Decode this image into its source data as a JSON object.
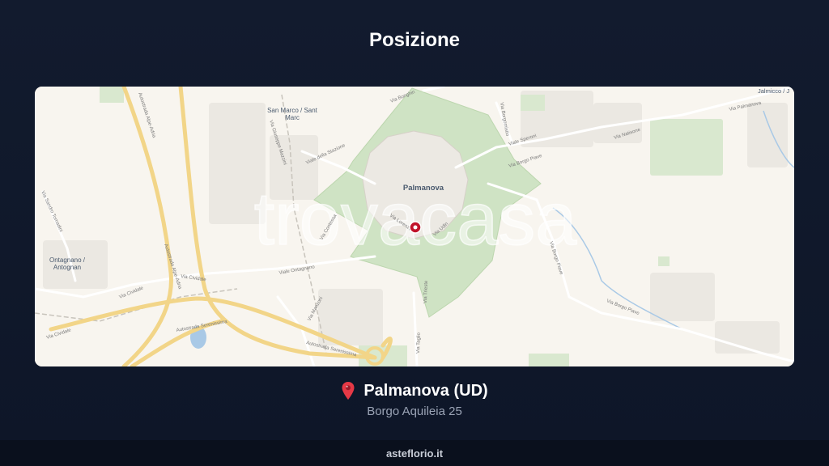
{
  "section": {
    "title": "Posizione"
  },
  "map": {
    "watermark": "trovacasa",
    "town_label": "Palmanova",
    "place_labels": {
      "san_marco_line1": "San Marco / Sant",
      "san_marco_line2": "Marc",
      "ontagnano_line1": "Ontagnano /",
      "ontagnano_line2": "Antognan",
      "jalmicco": "Jalmicco / J"
    },
    "road_labels": {
      "autostrada_alpe_adria_north": "Autostrada Alpe-Adria",
      "autostrada_alpe_adria_south": "Autostrada Alpe-Adria",
      "autostrada_serenissima_1": "Autostrada Serenissima",
      "autostrada_serenissima_2": "Autostrada Serenissima",
      "via_cividale_1": "Via Cividale",
      "via_cividale_2": "Via Cividale",
      "via_cividale_3": "Via Cividale",
      "viale_ontagnano": "Viale Ontagnano",
      "viale_della_stazione": "Viale della Stazione",
      "via_natisone": "Via Natisone",
      "via_palmanova": "Via Palmanova",
      "via_borgo_piave_1": "Via Borgo Piave",
      "via_borgo_piave_2": "Via Borgo Piave",
      "via_borgo_piave_3": "Via Borgo Piave",
      "viale_speroni": "Viale Speroni",
      "via_giuseppe_mazzini": "Via Giuseppe Mazzini",
      "via_sandro_tomadini": "Via Sandro Tomadini",
      "via_manzoni": "Via Manzoni",
      "via_taglio": "Via Taglio",
      "via_trieste": "Via Trieste",
      "via_bonghin": "Via Bonghin",
      "via_borgomistio": "Via Borgomistio",
      "via_contessa": "Via Contessa",
      "via_lorenzo": "Via Lorenzo",
      "via_udine": "Via Udin"
    },
    "colors": {
      "background": "#f8f5ef",
      "park": "#cfe3c4",
      "motorway": "#f2d588",
      "road": "#ffffff",
      "marker": "#c1132a",
      "water": "#a9c9e6"
    }
  },
  "location": {
    "icon": "map-pin-icon",
    "city": "Palmanova (UD)",
    "address": "Borgo Aquileia 25"
  },
  "footer": {
    "brand": "asteflorio.it"
  }
}
